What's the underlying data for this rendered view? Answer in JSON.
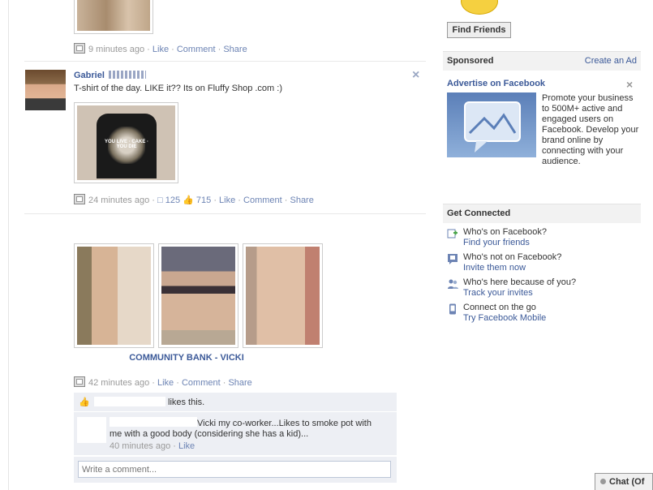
{
  "feed": {
    "post1": {
      "time": "9 minutes ago",
      "actions": [
        "Like",
        "Comment",
        "Share"
      ]
    },
    "post2": {
      "author": "Gabriel",
      "text": "T-shirt of the day. LIKE it?? Its on Fluffy Shop .com :)",
      "shirt_text": "YOU LIVE · CAKE · YOU DIE",
      "time": "24 minutes ago",
      "comments_count": "125",
      "likes_count": "715",
      "actions": [
        "Like",
        "Comment",
        "Share"
      ],
      "close_glyph": "×"
    },
    "post3": {
      "album_title": "COMMUNITY BANK - VICKI",
      "time": "42 minutes ago",
      "actions": [
        "Like",
        "Comment",
        "Share"
      ],
      "likes_text": "likes this.",
      "comment": {
        "text": "Vicki my co-worker...Likes to smoke pot with me with a good body (considering she has a kid)...",
        "time": "40 minutes ago",
        "like": "Like"
      },
      "write_placeholder": "Write a comment..."
    }
  },
  "sidebar": {
    "find_friends": "Find Friends",
    "sponsored": "Sponsored",
    "create_ad": "Create an Ad",
    "ad": {
      "title": "Advertise on Facebook",
      "body": "Promote your business to 500M+ active and engaged users on Facebook. Develop your brand online by connecting with your audience.",
      "close_glyph": "×"
    },
    "get_connected": "Get Connected",
    "items": [
      {
        "title": "Who's on Facebook?",
        "link": "Find your friends",
        "icon": "add-friend-icon"
      },
      {
        "title": "Who's not on Facebook?",
        "link": "Invite them now",
        "icon": "invite-icon"
      },
      {
        "title": "Who's here because of you?",
        "link": "Track your invites",
        "icon": "people-icon"
      },
      {
        "title": "Connect on the go",
        "link": "Try Facebook Mobile",
        "icon": "mobile-icon"
      }
    ]
  },
  "chat": {
    "label": "Chat (Of"
  },
  "colors": {
    "link": "#3b5998",
    "meta_link": "#6d84b4",
    "panel": "#edeff4"
  }
}
